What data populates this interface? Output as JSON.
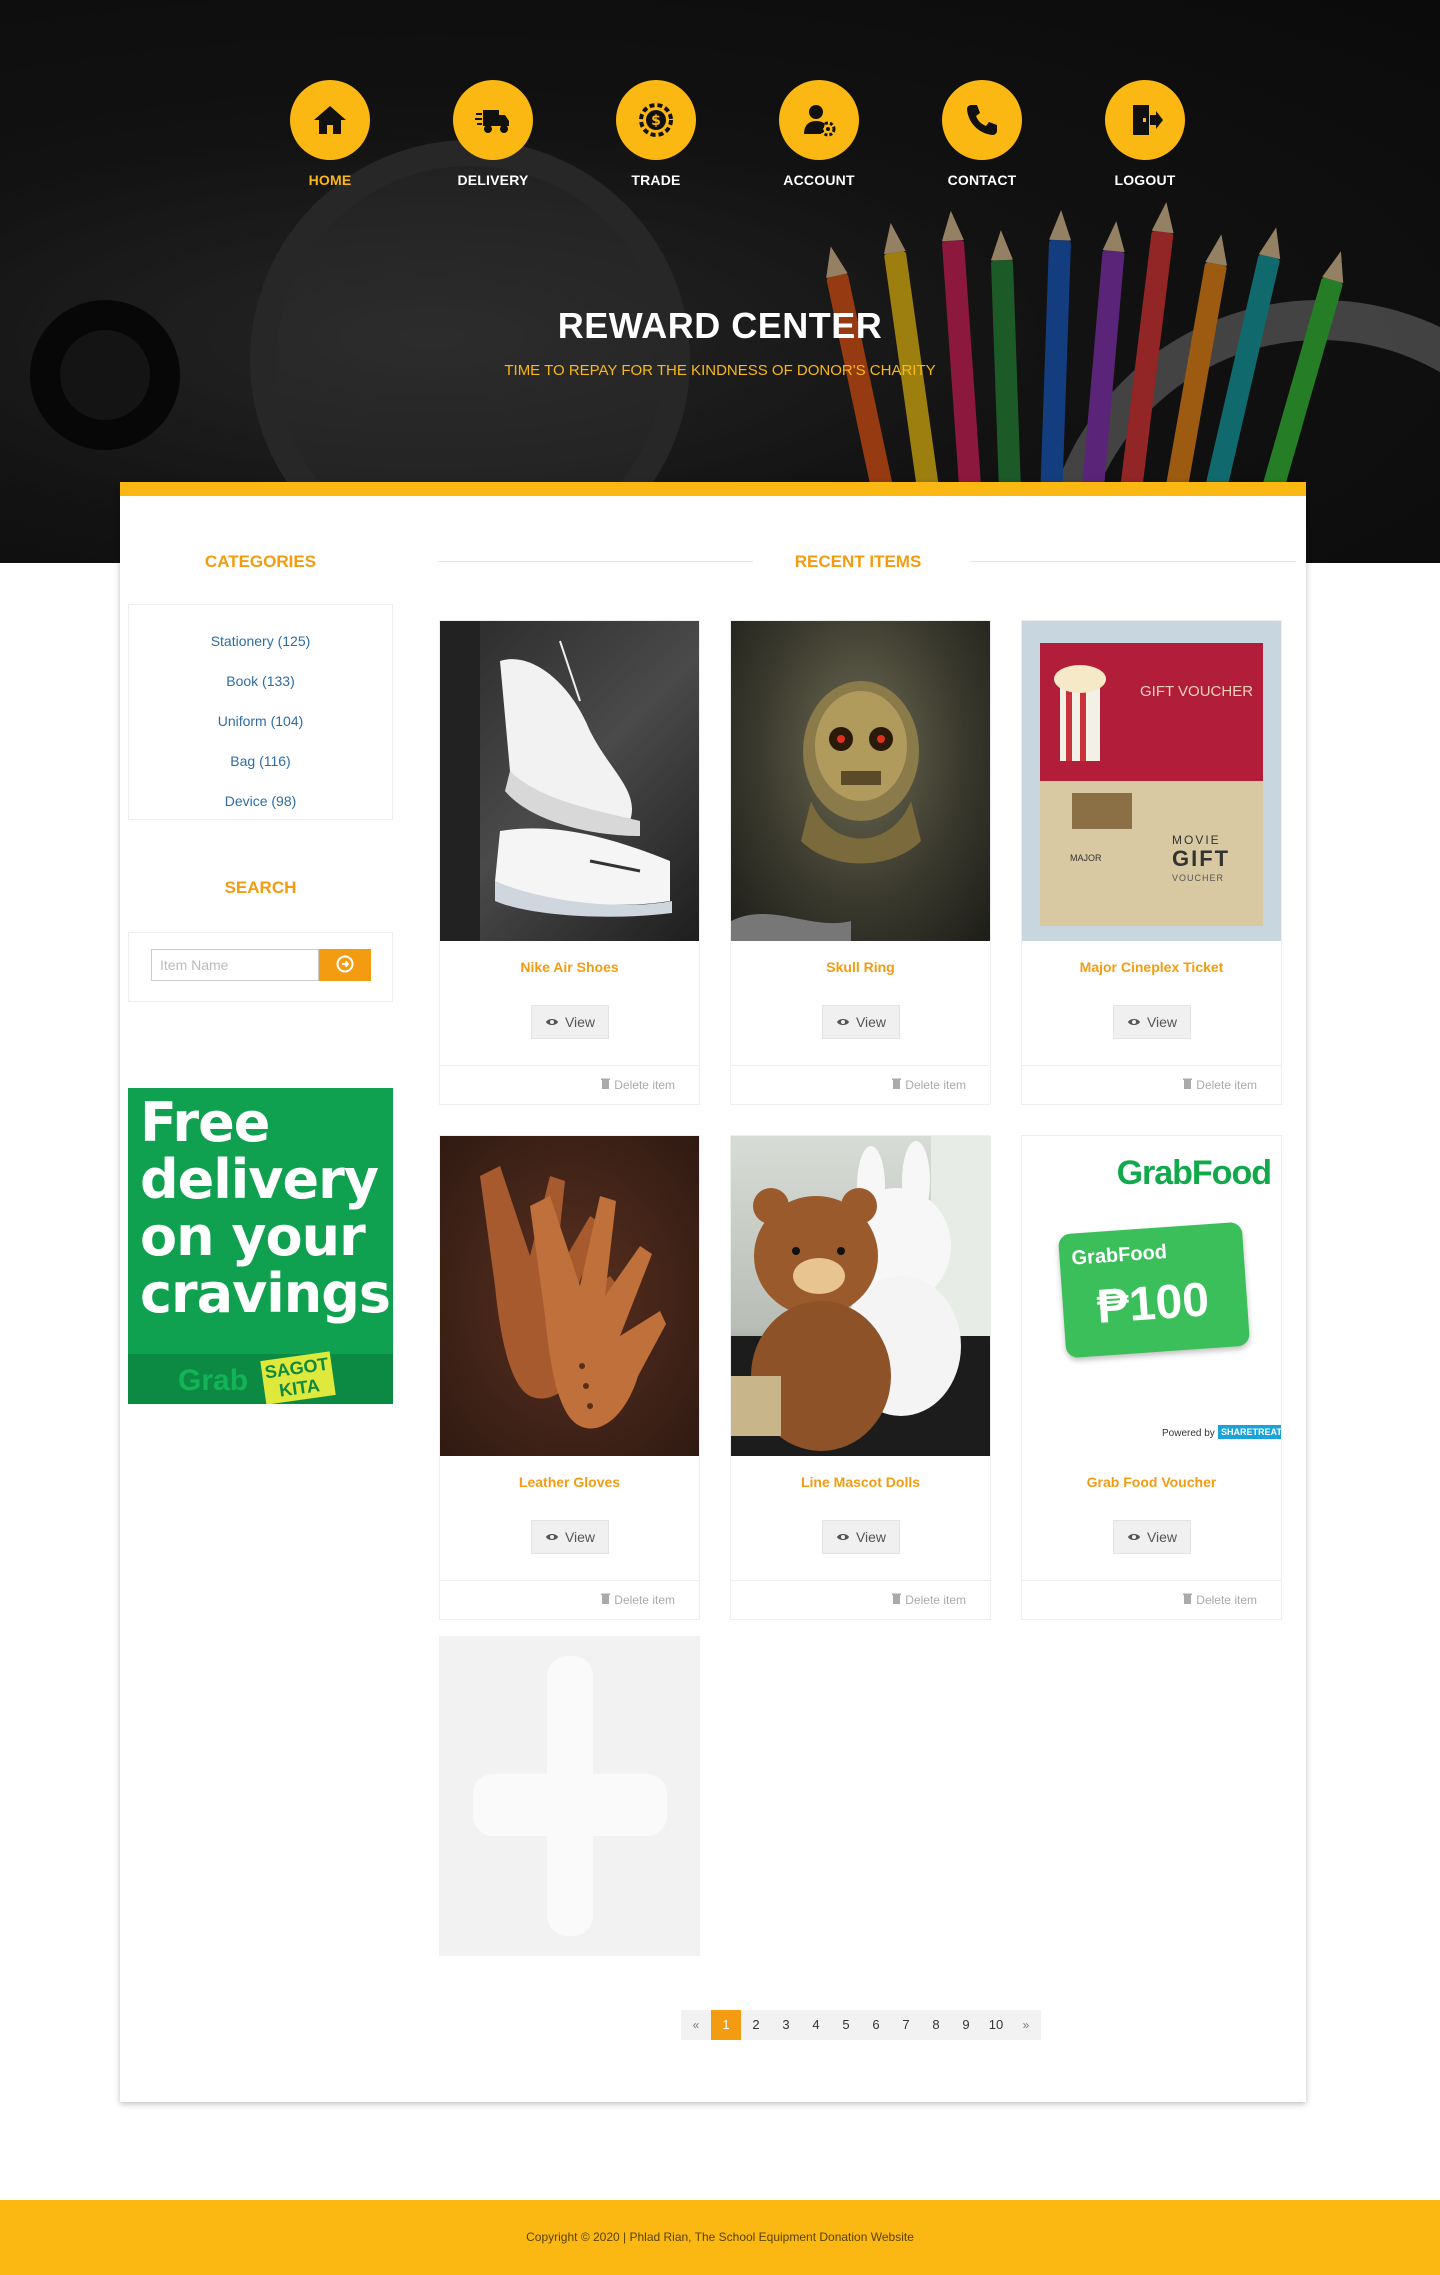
{
  "nav": {
    "items": [
      {
        "label": "HOME",
        "icon": "home-icon",
        "active": true
      },
      {
        "label": "DELIVERY",
        "icon": "truck-icon"
      },
      {
        "label": "TRADE",
        "icon": "dollar-gear-icon"
      },
      {
        "label": "ACCOUNT",
        "icon": "user-gear-icon"
      },
      {
        "label": "CONTACT",
        "icon": "phone-icon"
      },
      {
        "label": "LOGOUT",
        "icon": "exit-door-icon"
      }
    ]
  },
  "hero": {
    "title": "REWARD CENTER",
    "subtitle": "TIME TO REPAY FOR THE KINDNESS OF DONOR'S CHARITY"
  },
  "sidebar": {
    "categories_heading": "CATEGORIES",
    "categories": [
      {
        "label": "Stationery (125)"
      },
      {
        "label": "Book (133)"
      },
      {
        "label": "Uniform (104)"
      },
      {
        "label": "Bag (116)"
      },
      {
        "label": "Device (98)"
      }
    ],
    "search_heading": "SEARCH",
    "search_placeholder": "Item Name",
    "ad": {
      "text_line1": "Free",
      "text_line2": "delivery",
      "text_line3": "on your",
      "text_line4": "cravings!",
      "brand": "Grab",
      "sticker": "SAGOT KITA"
    }
  },
  "main": {
    "heading": "RECENT ITEMS",
    "view_label": "View",
    "delete_label": "Delete item",
    "items": [
      {
        "title": "Nike Air Shoes"
      },
      {
        "title": "Skull Ring"
      },
      {
        "title": "Major Cineplex Ticket",
        "img_text1": "GIFT VOUCHER",
        "img_text2": "MOVIE",
        "img_text3": "GIFT",
        "img_text4": "VOUCHER",
        "img_text5": "MAJOR"
      },
      {
        "title": "Leather Gloves"
      },
      {
        "title": "Line Mascot Dolls"
      },
      {
        "title": "Grab Food Voucher",
        "img_text1": "GrabFood",
        "img_text2": "GrabFood",
        "img_text3": "₱100",
        "img_text4": "Powered by",
        "img_text5": "SHARETREATS"
      }
    ]
  },
  "pagination": {
    "prev": "«",
    "next": "»",
    "pages": [
      "1",
      "2",
      "3",
      "4",
      "5",
      "6",
      "7",
      "8",
      "9",
      "10"
    ],
    "current": "1"
  },
  "footer": {
    "copyright": "Copyright © 2020 | Phlad Rian, The School Equipment Donation Website"
  },
  "colors": {
    "accent": "#fbb812",
    "orange": "#f39c12",
    "link": "#2e6da4"
  }
}
